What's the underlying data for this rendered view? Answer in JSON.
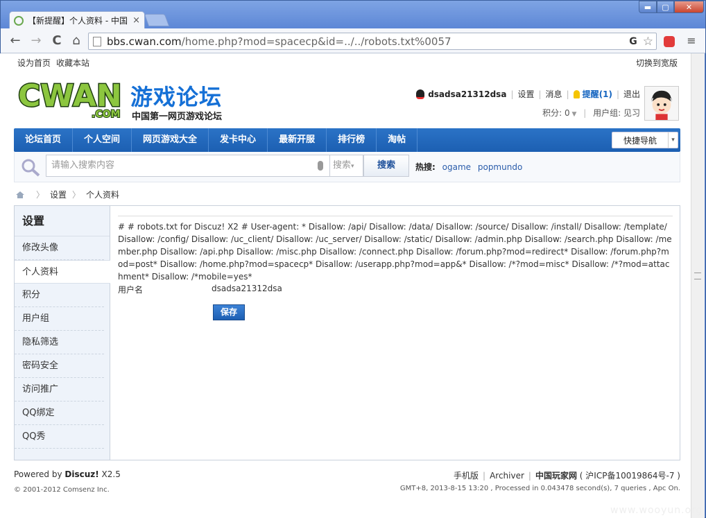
{
  "browser": {
    "tab_title": "【新提醒】个人资料 - 中国",
    "tab_close": "×",
    "min": "▬",
    "max": "▢",
    "close": "✕",
    "url_host": "bbs.cwan.com",
    "url_path": "/home.php?mod=spacecp&id=../../robots.txt%0057",
    "omni_g": "G",
    "back": "←",
    "forward": "→",
    "reload": "C",
    "home": "⌂",
    "star": "☆",
    "menu": "≡"
  },
  "topbar": {
    "set_home": "设为首页",
    "bookmark": "收藏本站",
    "wide": "切换到宽版"
  },
  "brand": {
    "logo_text": "游戏论坛",
    "sub": "中国第一网页游戏论坛"
  },
  "user": {
    "name": "dsadsa21312dsa",
    "settings": "设置",
    "messages": "消息",
    "notify": "提醒(1)",
    "logout": "退出",
    "credits": "积分: 0",
    "group": "用户组: 见习",
    "sep": "|"
  },
  "nav": {
    "items": [
      "论坛首页",
      "个人空间",
      "网页游戏大全",
      "发卡中心",
      "最新开服",
      "排行榜",
      "淘帖"
    ],
    "quick": "快捷导航",
    "quick_caret": "▾"
  },
  "search": {
    "placeholder": "请输入搜索内容",
    "type": "搜索",
    "caret": "▾",
    "button": "搜索",
    "hot_label": "热搜:",
    "hot": [
      "ogame",
      "popmundo"
    ]
  },
  "breadcrumb": {
    "sep": "〉",
    "items": [
      "设置",
      "个人资料"
    ]
  },
  "sidebar": {
    "title": "设置",
    "items": [
      "修改头像",
      "个人资料",
      "积分",
      "用户组",
      "隐私筛选",
      "密码安全",
      "访问推广",
      "QQ绑定",
      "QQ秀"
    ],
    "active": 1
  },
  "main": {
    "robots": "# # robots.txt for Discuz! X2 # User-agent: * Disallow: /api/ Disallow: /data/ Disallow: /source/ Disallow: /install/ Disallow: /template/ Disallow: /config/ Disallow: /uc_client/ Disallow: /uc_server/ Disallow: /static/ Disallow: /admin.php Disallow: /search.php Disallow: /member.php Disallow: /api.php Disallow: /misc.php Disallow: /connect.php Disallow: /forum.php?mod=redirect* Disallow: /forum.php?mod=post* Disallow: /home.php?mod=spacecp* Disallow: /userapp.php?mod=app&* Disallow: /*?mod=misc* Disallow: /*?mod=attachment* Disallow: /*mobile=yes*",
    "username_label": "用户名",
    "username_value": "dsadsa21312dsa",
    "save": "保存"
  },
  "footer": {
    "powered_prefix": "Powered by ",
    "powered_name": "Discuz!",
    "powered_ver": " X2.5",
    "copyright": "© 2001-2012 Comsenz Inc.",
    "mobile": "手机版",
    "archiver": "Archiver",
    "site": "中国玩家网",
    "icp": "( 沪ICP备10019864号-7 )",
    "sep": "|",
    "stats": "GMT+8, 2013-8-15 13:20 , Processed in 0.043478 second(s), 7 queries , Apc On."
  },
  "watermark": "www.wooyun.org"
}
